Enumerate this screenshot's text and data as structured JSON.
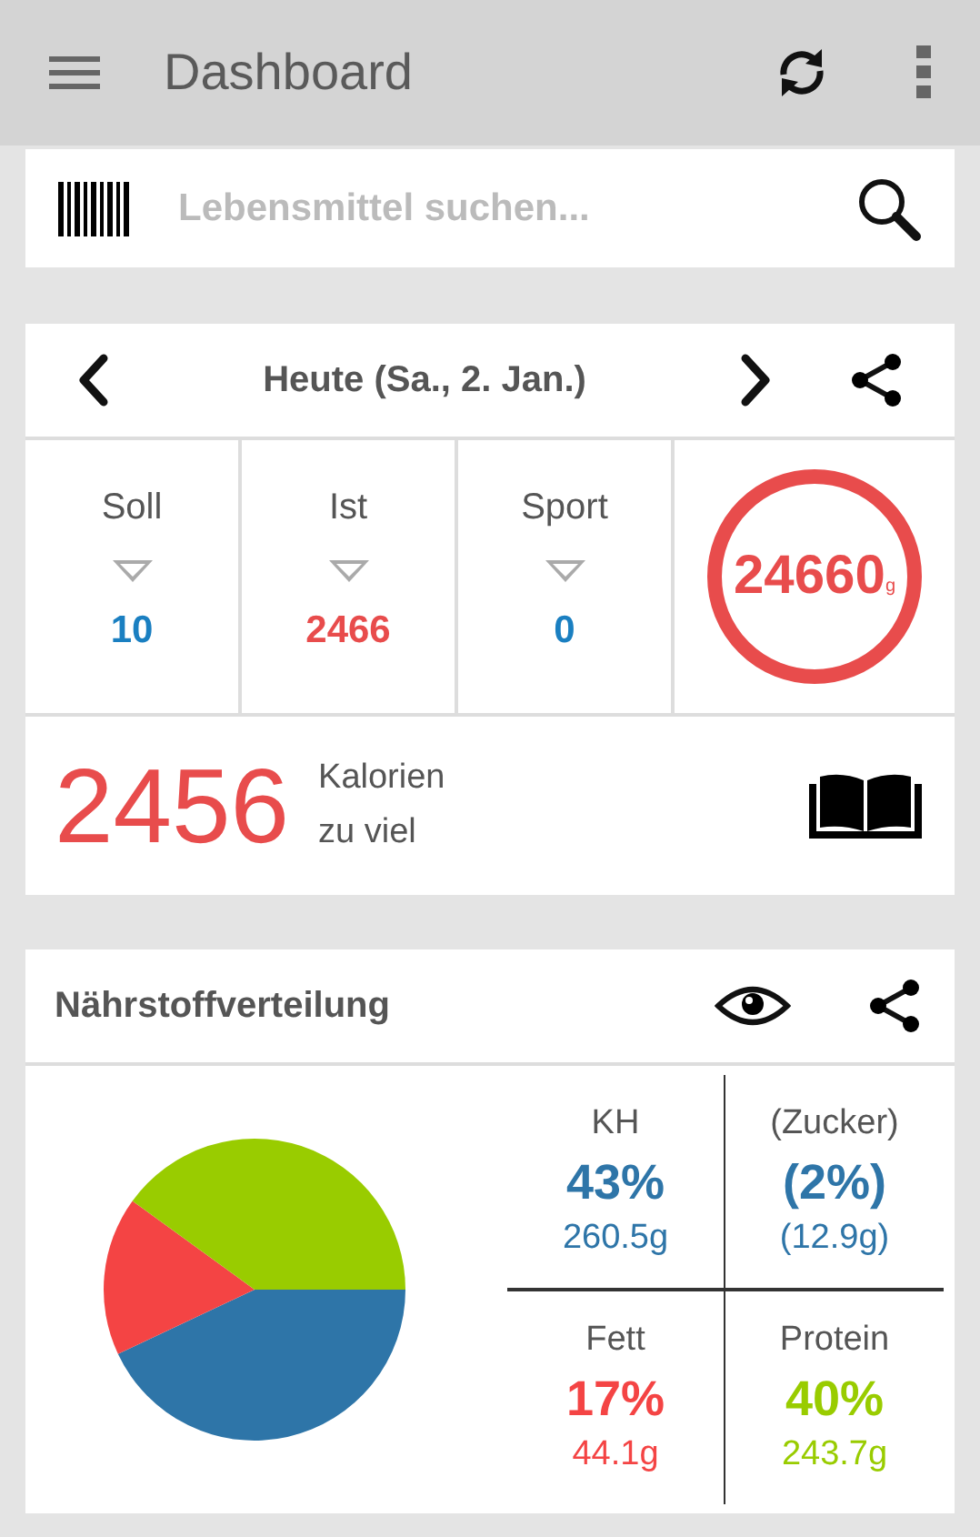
{
  "app_bar": {
    "title": "Dashboard"
  },
  "search": {
    "placeholder": "Lebensmittel suchen..."
  },
  "day": {
    "title": "Heute (Sa., 2. Jan.)",
    "stats": [
      {
        "label": "Soll",
        "value": "10",
        "color": "#1a7fc1"
      },
      {
        "label": "Ist",
        "value": "2466",
        "color": "#e84c4c"
      },
      {
        "label": "Sport",
        "value": "0",
        "color": "#1a7fc1"
      }
    ],
    "ring": {
      "value": "24660",
      "unit": "g"
    },
    "summary": {
      "value": "2456",
      "line1": "Kalorien",
      "line2": "zu viel"
    }
  },
  "nutrients": {
    "title": "Nährstoffverteilung",
    "chart_data": {
      "type": "pie",
      "series": [
        {
          "values": [
            43,
            17,
            40
          ]
        }
      ],
      "colors": [
        "#2e75a8",
        "#f44444",
        "#99cc00"
      ]
    },
    "tiles": [
      {
        "label": "KH",
        "percent": "43%",
        "grams": "260.5g",
        "color": "#2e75a8"
      },
      {
        "label": "(Zucker)",
        "percent": "(2%)",
        "grams": "(12.9g)",
        "color": "#2e75a8"
      },
      {
        "label": "Fett",
        "percent": "17%",
        "grams": "44.1g",
        "color": "#f44444"
      },
      {
        "label": "Protein",
        "percent": "40%",
        "grams": "243.7g",
        "color": "#99cc00"
      }
    ]
  }
}
